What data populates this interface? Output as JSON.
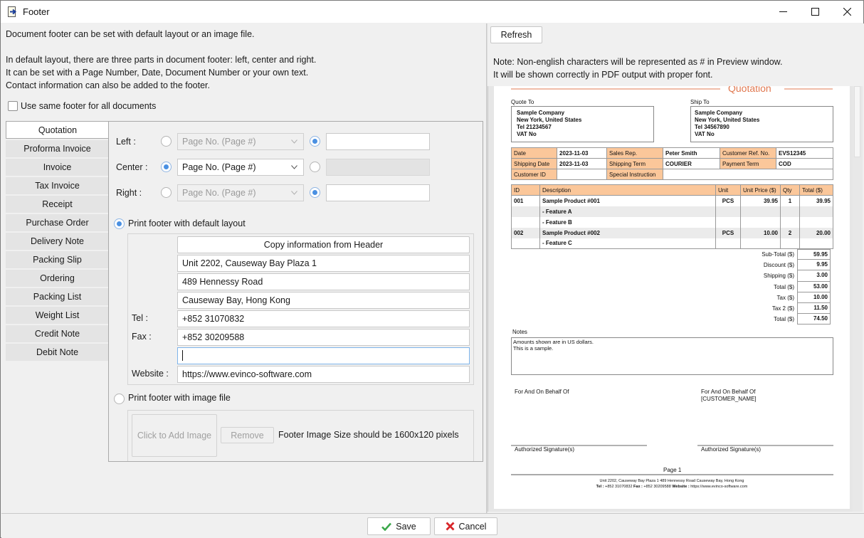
{
  "window": {
    "title": "Footer",
    "controls": {
      "minimize": "minimize-icon",
      "maximize": "maximize-icon",
      "close": "close-icon"
    }
  },
  "intro": {
    "line1": "Document footer can be set with default layout or an image file.",
    "line2": "In default layout, there are three parts in document footer: left, center and right.",
    "line3": "It can be set with a Page Number, Date, Document Number or your own text.",
    "line4": "Contact information can also be added to the footer."
  },
  "same_footer": {
    "label": "Use same footer for all documents",
    "checked": false
  },
  "document_tabs": [
    {
      "label": "Quotation",
      "active": true
    },
    {
      "label": "Proforma Invoice"
    },
    {
      "label": "Invoice"
    },
    {
      "label": "Tax Invoice"
    },
    {
      "label": "Receipt"
    },
    {
      "label": "Purchase Order"
    },
    {
      "label": "Delivery Note"
    },
    {
      "label": "Packing Slip"
    },
    {
      "label": "Ordering"
    },
    {
      "label": "Packing List"
    },
    {
      "label": "Weight List"
    },
    {
      "label": "Credit Note"
    },
    {
      "label": "Debit Note"
    }
  ],
  "parts": {
    "left": {
      "label": "Left :",
      "select_value": "Page No. (Page #)",
      "mode": "text",
      "text_value": ""
    },
    "center": {
      "label": "Center :",
      "select_value": "Page No. (Page #)",
      "mode": "select",
      "text_value": ""
    },
    "right": {
      "label": "Right :",
      "select_value": "Page No. (Page #)",
      "mode": "text",
      "text_value": ""
    }
  },
  "default_layout": {
    "label": "Print footer with default layout",
    "selected": true,
    "copy_button": "Copy information from Header",
    "address1": "Unit 2202, Causeway Bay Plaza 1",
    "address2": "489 Hennessy Road",
    "address3": "Causeway Bay, Hong Kong",
    "tel_label": "Tel :",
    "tel": "+852 31070832",
    "fax_label": "Fax :",
    "fax": "+852 30209588",
    "extra": "",
    "website_label": "Website :",
    "website": "https://www.evinco-software.com"
  },
  "image_layout": {
    "label": "Print footer with image file",
    "selected": false,
    "add_image": "Click to Add Image",
    "remove": "Remove",
    "hint": "Footer Image Size should be 1600x120 pixels"
  },
  "preview_panel": {
    "refresh": "Refresh",
    "note1": "Note: Non-english characters will be represented as # in Preview window.",
    "note2": "It will be shown correctly in PDF output with proper font."
  },
  "document": {
    "title": "Quotation",
    "accent_color": "#e07850",
    "header_fill": "#fbc79a",
    "quote_to": {
      "label": "Quote To",
      "lines": [
        "Sample Company",
        "New York, United States",
        "Tel 21234567",
        "VAT No"
      ]
    },
    "ship_to": {
      "label": "Ship To",
      "lines": [
        "Sample Company",
        "New York, United States",
        "Tel 34567890",
        "VAT No"
      ]
    },
    "info": [
      [
        {
          "k": "Date"
        },
        {
          "v": "2023-11-03"
        },
        {
          "k": "Sales Rep."
        },
        {
          "v": "Peter Smith"
        },
        {
          "k": "Customer Ref. No."
        },
        {
          "v": "EVS12345"
        }
      ],
      [
        {
          "k": "Shipping Date"
        },
        {
          "v": "2023-11-03"
        },
        {
          "k": "Shipping Term"
        },
        {
          "v": "COURIER"
        },
        {
          "k": "Payment Term"
        },
        {
          "v": "COD"
        }
      ],
      [
        {
          "k": "Customer ID"
        },
        {
          "v": ""
        },
        {
          "k": "Special Instruction"
        },
        {
          "v": ""
        }
      ]
    ],
    "items_header": [
      "ID",
      "Description",
      "Unit",
      "Unit Price ($)",
      "Qty",
      "Total ($)"
    ],
    "items": [
      [
        "001",
        "Sample Product #001",
        "PCS",
        "39.95",
        "1",
        "39.95"
      ],
      [
        "",
        "- Feature A",
        "",
        "",
        "",
        ""
      ],
      [
        "",
        "- Feature B",
        "",
        "",
        "",
        ""
      ],
      [
        "002",
        "Sample Product #002",
        "PCS",
        "10.00",
        "2",
        "20.00"
      ],
      [
        "",
        "- Feature C",
        "",
        "",
        "",
        ""
      ]
    ],
    "totals": [
      {
        "k": "Sub-Total ($)",
        "v": "59.95"
      },
      {
        "k": "Discount ($)",
        "v": "9.95"
      },
      {
        "k": "Shipping ($)",
        "v": "3.00"
      },
      {
        "k": "Total ($)",
        "v": "53.00"
      },
      {
        "k": "Tax ($)",
        "v": "10.00"
      },
      {
        "k": "Tax 2 ($)",
        "v": "11.50"
      },
      {
        "k": "Total ($)",
        "v": "74.50"
      }
    ],
    "notes_label": "Notes",
    "notes": [
      "Amounts shown are in US dollars.",
      "This is a sample."
    ],
    "behalf_left": "For And On Behalf Of",
    "behalf_right1": "For And On Behalf Of",
    "behalf_right2": "[CUSTOMER_NAME]",
    "signature": "Authorized Signature(s)",
    "page_label": "Page 1",
    "footer_line1": "Unit 2202, Causeway Bay Plaza 1 489 Hennessy Road Causeway Bay, Hong Kong",
    "footer_tel_label": "Tel :",
    "footer_tel": "+852 31070832",
    "footer_fax_label": "Fax :",
    "footer_fax": "+852 30209588",
    "footer_web_label": "Website :",
    "footer_web": "https://www.evinco-software.com"
  },
  "actions": {
    "save": "Save",
    "cancel": "Cancel"
  }
}
